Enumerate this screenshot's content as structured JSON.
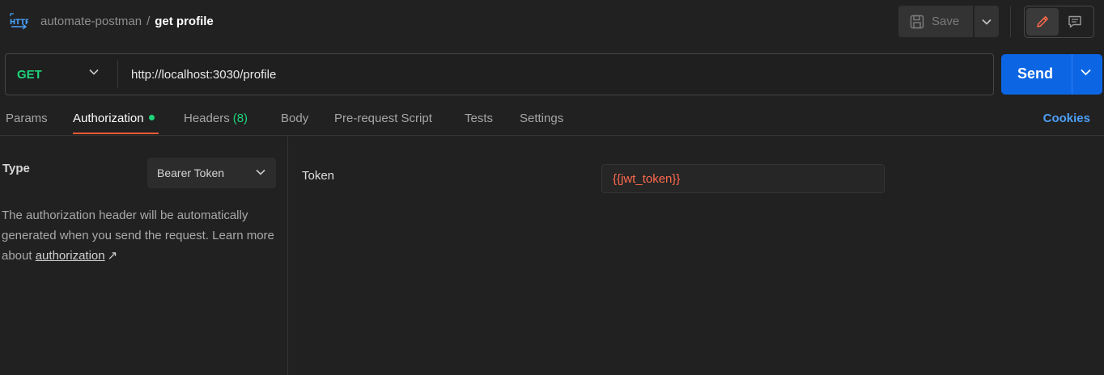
{
  "header": {
    "collection": "automate-postman",
    "separator": "/",
    "request_name": "get profile",
    "save_label": "Save",
    "icons": [
      "http-icon",
      "save-icon",
      "chevron-down-icon",
      "pencil-icon",
      "comment-icon"
    ]
  },
  "request": {
    "method": "GET",
    "url": "http://localhost:3030/profile",
    "send_label": "Send"
  },
  "tabs": [
    {
      "label": "Params",
      "active": false
    },
    {
      "label": "Authorization",
      "active": true,
      "indicator": "green-dot"
    },
    {
      "label": "Headers",
      "count": "(8)",
      "active": false
    },
    {
      "label": "Body",
      "active": false
    },
    {
      "label": "Pre-request Script",
      "active": false
    },
    {
      "label": "Tests",
      "active": false
    },
    {
      "label": "Settings",
      "active": false
    }
  ],
  "cookies_label": "Cookies",
  "auth": {
    "type_label": "Type",
    "type_value": "Bearer Token",
    "help_prefix": "The authorization header will be automatically generated when you send the request. Learn more about",
    "help_link": "authorization",
    "help_arrow": "↗",
    "token_label": "Token",
    "token_value": "{{jwt_token}}"
  },
  "colors": {
    "background": "#212121",
    "method_get": "#1ed47a",
    "send_button": "#0c66e4",
    "active_tab_underline": "#ff5a36",
    "cookies_link": "#4d9ff5",
    "token_variable": "#ff6a4d",
    "edit_icon": "#ff6a4d"
  }
}
